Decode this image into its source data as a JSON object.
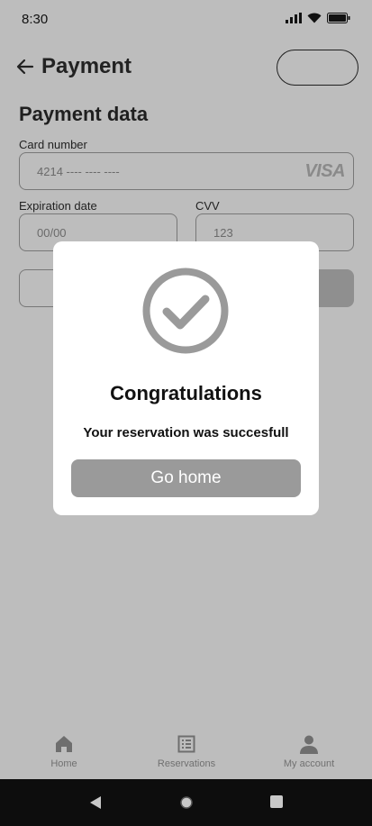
{
  "status": {
    "time": "8:30"
  },
  "header": {
    "title": "Payment",
    "pill_label": ""
  },
  "form": {
    "section_title": "Payment data",
    "card_number_label": "Card number",
    "card_number_value": "4214 ---- ---- ----",
    "card_brand": "VISA",
    "expiration_label": "Expiration date",
    "expiration_value": "00/00",
    "cvv_label": "CVV",
    "cvv_value": "123"
  },
  "modal": {
    "title": "Congratulations",
    "message": "Your reservation was succesfull",
    "button_label": "Go home"
  },
  "bottom_nav": {
    "items": [
      {
        "label": "Home",
        "icon": "home-icon"
      },
      {
        "label": "Reservations",
        "icon": "list-icon"
      },
      {
        "label": "My account",
        "icon": "person-icon"
      }
    ]
  },
  "colors": {
    "overlay_background": "#bdbdbd",
    "modal_background": "#ffffff",
    "button_gray": "#9a9a9a",
    "system_nav": "#0d0d0d"
  }
}
